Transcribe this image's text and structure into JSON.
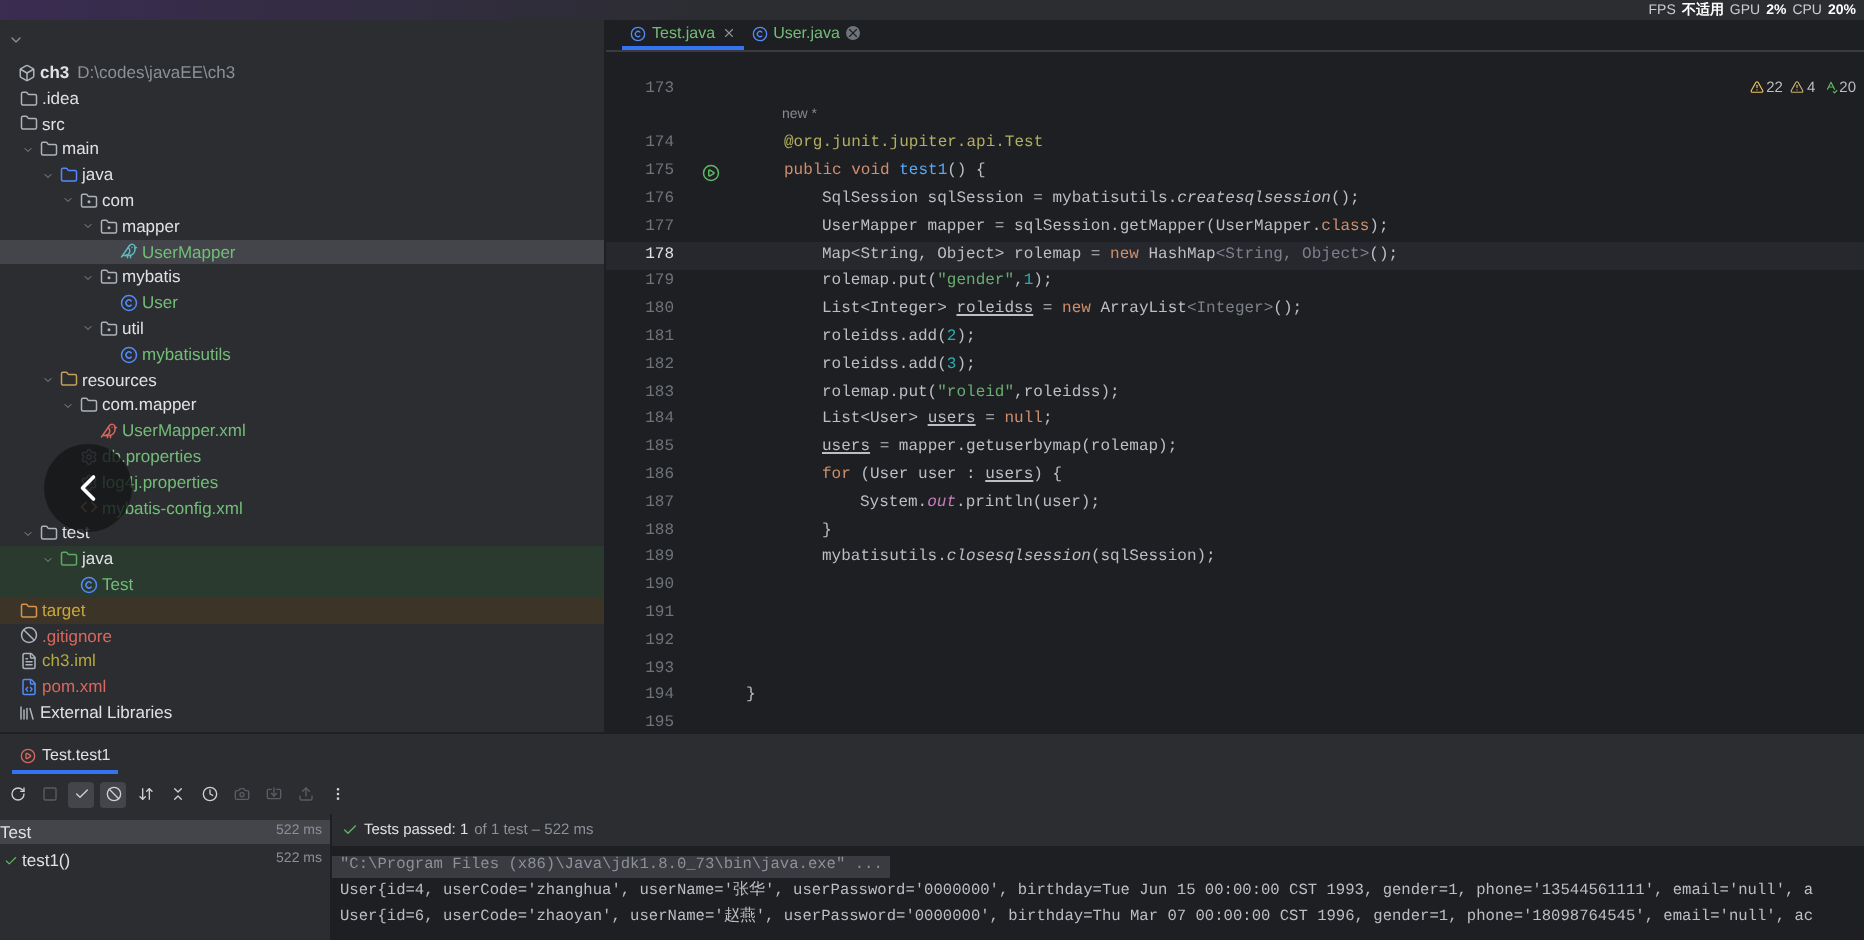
{
  "system_stats": [
    "FPS",
    "不适用",
    "GPU",
    "2%",
    "CPU",
    "20%"
  ],
  "project_tree": [
    {
      "label": "ch3",
      "path": "D:\\codes\\javaEE\\ch3",
      "kind": "module",
      "selected": false,
      "children": [
        {
          "label": ".idea",
          "kind": "folder",
          "selected": false
        },
        {
          "label": "src",
          "kind": "folder",
          "selected": false,
          "children": [
            {
              "label": "main",
              "kind": "folder",
              "expanded": true,
              "selected": false,
              "children": [
                {
                  "label": "java",
                  "kind": "source-folder",
                  "expanded": true,
                  "selected": false,
                  "children": [
                    {
                      "label": "com",
                      "kind": "package",
                      "expanded": true,
                      "selected": false,
                      "children": [
                        {
                          "label": "mapper",
                          "kind": "package",
                          "expanded": true,
                          "selected": false,
                          "children": [
                            {
                              "label": "UserMapper",
                              "kind": "mapper",
                              "color": "#73bd79",
                              "selected": true
                            }
                          ]
                        },
                        {
                          "label": "mybatis",
                          "kind": "package",
                          "expanded": true,
                          "selected": false,
                          "children": [
                            {
                              "label": "User",
                              "kind": "class",
                              "color": "#73bd79",
                              "selected": false
                            }
                          ]
                        },
                        {
                          "label": "util",
                          "kind": "package",
                          "expanded": true,
                          "selected": false,
                          "children": [
                            {
                              "label": "mybatisutils",
                              "kind": "class",
                              "color": "#73bd79",
                              "selected": false
                            }
                          ]
                        }
                      ]
                    }
                  ]
                },
                {
                  "label": "resources",
                  "kind": "resource-folder",
                  "expanded": true,
                  "selected": false,
                  "children": [
                    {
                      "label": "com.mapper",
                      "kind": "folder",
                      "expanded": true,
                      "selected": false,
                      "children": [
                        {
                          "label": "UserMapper.xml",
                          "kind": "mapper-xml",
                          "color": "#73bd79",
                          "selected": false
                        }
                      ]
                    },
                    {
                      "label": "db.properties",
                      "kind": "properties",
                      "color": "#73bd79",
                      "selected": false
                    },
                    {
                      "label": "log4j.properties",
                      "kind": "properties",
                      "color": "#73bd79",
                      "selected": false
                    },
                    {
                      "label": "mybatis-config.xml",
                      "kind": "xml",
                      "color": "#73bd79",
                      "selected": false
                    }
                  ]
                }
              ]
            },
            {
              "label": "test",
              "kind": "folder",
              "expanded": true,
              "selected": false,
              "children": [
                {
                  "label": "java",
                  "kind": "test-folder",
                  "expanded": true,
                  "selected": false,
                  "children": [
                    {
                      "label": "Test",
                      "kind": "test-class",
                      "color": "#73bd79",
                      "selected": false
                    }
                  ]
                }
              ]
            }
          ]
        },
        {
          "label": "target",
          "kind": "excluded-folder",
          "color": "#c9a83a",
          "selected": false
        },
        {
          "label": ".gitignore",
          "kind": "gitignore",
          "color": "#d9675f",
          "selected": false
        },
        {
          "label": "ch3.iml",
          "kind": "iml",
          "color": "#b5a93c",
          "selected": false
        },
        {
          "label": "pom.xml",
          "kind": "maven",
          "color": "#d9675f",
          "selected": false
        }
      ]
    },
    {
      "label": "External Libraries",
      "kind": "library",
      "selected": false
    }
  ],
  "editor_tabs": [
    {
      "label": "Test.java",
      "selected": true
    },
    {
      "label": "User.java",
      "selected": false
    }
  ],
  "inspections": [
    {
      "kind": "warning",
      "count": "22"
    },
    {
      "kind": "weak-warning",
      "count": "4"
    },
    {
      "kind": "typo",
      "count": "20"
    }
  ],
  "code_lines": [
    {
      "number": "173"
    },
    {
      "kind": "hint",
      "text": "new *"
    },
    {
      "number": "174",
      "kind": "indent-1",
      "tokens": [
        {
          "kind": "ann",
          "text": "@org.junit.jupiter.api.Test"
        }
      ]
    },
    {
      "number": "175",
      "kind": "indent-1",
      "run": true,
      "tokens": [
        {
          "kind": "kw",
          "text": "public void"
        },
        {
          "kind": "fn",
          "text": " test1"
        },
        {
          "kind": "plain",
          "text": "() {"
        }
      ]
    },
    {
      "number": "176",
      "kind": "indent-2",
      "tokens": [
        {
          "kind": "plain",
          "text": "SqlSession sqlSession = mybatisutils."
        },
        {
          "kind": "italic",
          "text": "createsqlsession"
        },
        {
          "kind": "plain",
          "text": "();"
        }
      ]
    },
    {
      "number": "177",
      "kind": "indent-2",
      "tokens": [
        {
          "kind": "plain",
          "text": "UserMapper mapper = sqlSession.getMapper(UserMapper."
        },
        {
          "kind": "kw",
          "text": "class"
        },
        {
          "kind": "plain",
          "text": ");"
        }
      ]
    },
    {
      "number": "178",
      "kind": "indent-2",
      "current": true,
      "tokens": [
        {
          "kind": "plain",
          "text": "Map<String, Object> rolemap = "
        },
        {
          "kind": "kw",
          "text": "new"
        },
        {
          "kind": "plain",
          "text": " HashMap"
        },
        {
          "kind": "gray",
          "text": "<String, Object>"
        },
        {
          "kind": "plain",
          "text": "();"
        }
      ]
    },
    {
      "number": "179",
      "kind": "indent-2",
      "tokens": [
        {
          "kind": "plain",
          "text": "rolemap.put("
        },
        {
          "kind": "str",
          "text": "\"gender\""
        },
        {
          "kind": "plain",
          "text": ","
        },
        {
          "kind": "num",
          "text": "1"
        },
        {
          "kind": "plain",
          "text": ");"
        }
      ]
    },
    {
      "number": "180",
      "kind": "indent-2",
      "tokens": [
        {
          "kind": "plain",
          "text": "List<Integer> "
        },
        {
          "kind": "under",
          "text": "roleidss"
        },
        {
          "kind": "plain",
          "text": " = "
        },
        {
          "kind": "kw",
          "text": "new"
        },
        {
          "kind": "plain",
          "text": " ArrayList"
        },
        {
          "kind": "gray",
          "text": "<Integer>"
        },
        {
          "kind": "plain",
          "text": "();"
        }
      ]
    },
    {
      "number": "181",
      "kind": "indent-2",
      "tokens": [
        {
          "kind": "plain",
          "text": "roleidss.add("
        },
        {
          "kind": "num",
          "text": "2"
        },
        {
          "kind": "plain",
          "text": ");"
        }
      ]
    },
    {
      "number": "182",
      "kind": "indent-2",
      "tokens": [
        {
          "kind": "plain",
          "text": "roleidss.add("
        },
        {
          "kind": "num",
          "text": "3"
        },
        {
          "kind": "plain",
          "text": ");"
        }
      ]
    },
    {
      "number": "183",
      "kind": "indent-2",
      "tokens": [
        {
          "kind": "plain",
          "text": "rolemap.put("
        },
        {
          "kind": "str",
          "text": "\"roleid\""
        },
        {
          "kind": "plain",
          "text": ",roleidss);"
        }
      ]
    },
    {
      "number": "184",
      "kind": "indent-2",
      "tokens": [
        {
          "kind": "plain",
          "text": "List<User> "
        },
        {
          "kind": "under",
          "text": "users"
        },
        {
          "kind": "plain",
          "text": " = "
        },
        {
          "kind": "kw",
          "text": "null"
        },
        {
          "kind": "plain",
          "text": ";"
        }
      ]
    },
    {
      "number": "185",
      "kind": "indent-2",
      "tokens": [
        {
          "kind": "under",
          "text": "users"
        },
        {
          "kind": "plain",
          "text": " = mapper.getuserbymap(rolemap);"
        }
      ]
    },
    {
      "number": "186",
      "kind": "indent-2",
      "tokens": [
        {
          "kind": "kw",
          "text": "for"
        },
        {
          "kind": "plain",
          "text": " (User user : "
        },
        {
          "kind": "under",
          "text": "users"
        },
        {
          "kind": "plain",
          "text": ") {"
        }
      ]
    },
    {
      "number": "187",
      "kind": "indent-3",
      "tokens": [
        {
          "kind": "plain",
          "text": "System."
        },
        {
          "kind": "field",
          "text": "out"
        },
        {
          "kind": "plain",
          "text": ".println(user);"
        }
      ]
    },
    {
      "number": "188",
      "kind": "indent-2",
      "tokens": [
        {
          "kind": "plain",
          "text": "}"
        }
      ]
    },
    {
      "number": "189",
      "kind": "indent-2",
      "tokens": [
        {
          "kind": "plain",
          "text": "mybatisutils."
        },
        {
          "kind": "italic",
          "text": "closesqlsession"
        },
        {
          "kind": "plain",
          "text": "(sqlSession);"
        }
      ]
    },
    {
      "number": "190"
    },
    {
      "number": "191"
    },
    {
      "number": "192"
    },
    {
      "number": "193"
    },
    {
      "number": "194",
      "tokens": [
        {
          "kind": "plain",
          "text": "}"
        }
      ]
    },
    {
      "number": "195"
    }
  ],
  "run_tab": {
    "label": "Test.test1",
    "selected": true
  },
  "run_toolbar": [
    {
      "kind": "rerun",
      "selected": false,
      "disabled": false
    },
    {
      "kind": "stop",
      "selected": false,
      "disabled": true
    },
    {
      "kind": "show-passed",
      "selected": true,
      "disabled": false
    },
    {
      "kind": "show-ignored",
      "selected": true,
      "disabled": false
    },
    {
      "kind": "sort",
      "selected": false,
      "disabled": false
    },
    {
      "kind": "collapse",
      "selected": false,
      "disabled": false
    },
    {
      "kind": "history",
      "selected": false,
      "disabled": false
    },
    {
      "kind": "camera",
      "selected": false,
      "disabled": true
    },
    {
      "kind": "import",
      "selected": false,
      "disabled": true
    },
    {
      "kind": "export",
      "selected": false,
      "disabled": true
    },
    {
      "kind": "more",
      "selected": false,
      "disabled": false
    }
  ],
  "test_tree": [
    {
      "label": "Test",
      "time": "522 ms",
      "selected": true,
      "children": [
        {
          "label": "test1()",
          "time": "522 ms",
          "passed": true,
          "selected": false
        }
      ]
    }
  ],
  "test_summary": {
    "main": "Tests passed: 1",
    "detail": "of 1 test – 522 ms"
  },
  "console": [
    {
      "kind": "command",
      "text": "\"C:\\Program Files (x86)\\Java\\jdk1.8.0_73\\bin\\java.exe\" ..."
    },
    {
      "kind": "output",
      "text": "User{id=4, userCode='zhanghua', userName='张华', userPassword='0000000', birthday=Tue Jun 15 00:00:00 CST 1993, gender=1, phone='13544561111', email='null', a"
    },
    {
      "kind": "output",
      "text": "User{id=6, userCode='zhaoyan', userName='赵燕', userPassword='0000000', birthday=Thu Mar 07 00:00:00 CST 1996, gender=1, phone='18098764545', email='null', ac"
    }
  ]
}
